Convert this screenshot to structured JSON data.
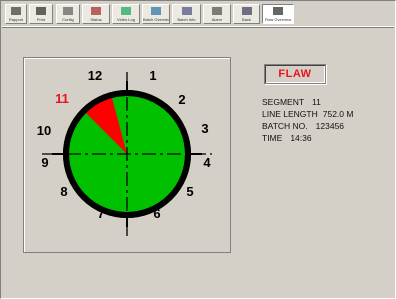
{
  "toolbar": {
    "buttons": [
      {
        "label": "Rapport",
        "icon": "report-icon"
      },
      {
        "label": "Print",
        "icon": "printer-icon"
      },
      {
        "label": "Config",
        "icon": "config-icon"
      },
      {
        "label": "Status",
        "icon": "status-icon"
      },
      {
        "label": "Vidéo Log",
        "icon": "video-log-icon"
      },
      {
        "label": "Batch Overview",
        "icon": "batch-overview-icon"
      },
      {
        "label": "Batch Info",
        "icon": "batch-info-icon"
      },
      {
        "label": "Alarm",
        "icon": "alarm-icon"
      },
      {
        "label": "Back",
        "icon": "back-icon"
      },
      {
        "label": "Flaw Overview",
        "icon": "flaw-overview-icon",
        "active": true
      }
    ]
  },
  "clock": {
    "numbers": [
      "12",
      "1",
      "2",
      "3",
      "4",
      "5",
      "6",
      "7",
      "8",
      "9",
      "10",
      "11"
    ],
    "flaw_segment": 11,
    "colors": {
      "face": "#00c000",
      "flaw": "#ff0000",
      "rim": "#000000",
      "flaw_label": "#e8141c"
    }
  },
  "flaw_label": "FLAW",
  "info": {
    "segment_label": "SEGMENT",
    "segment_value": "11",
    "line_length_label": "LINE LENGTH",
    "line_length_value": "752.0 M",
    "batch_label": "BATCH NO.",
    "batch_value": "123456",
    "time_label": "TIME",
    "time_value": "14:36"
  }
}
